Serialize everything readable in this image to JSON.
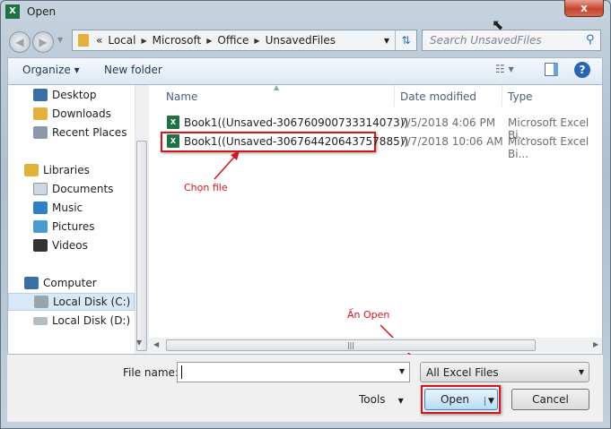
{
  "window": {
    "title": "Open",
    "close_label": "x",
    "app_icon": "excel-icon"
  },
  "address": {
    "overflow": "«",
    "crumbs": [
      "Local",
      "Microsoft",
      "Office",
      "UnsavedFiles"
    ]
  },
  "search": {
    "placeholder": "Search UnsavedFiles"
  },
  "toolbar": {
    "organize": "Organize ▾",
    "new_folder": "New folder"
  },
  "sidebar": {
    "items": [
      {
        "label": "Desktop",
        "icon": "desktop-icon",
        "color": "#3a6ea5"
      },
      {
        "label": "Downloads",
        "icon": "downloads-folder-icon",
        "color": "#e2b13c"
      },
      {
        "label": "Recent Places",
        "icon": "recent-places-icon",
        "color": "#8a98a8"
      },
      {
        "label": "Libraries",
        "icon": "libraries-icon",
        "color": "#e2b13c"
      },
      {
        "label": "Documents",
        "icon": "documents-icon",
        "color": "#cfd8e2"
      },
      {
        "label": "Music",
        "icon": "music-icon",
        "color": "#2f7fc8"
      },
      {
        "label": "Pictures",
        "icon": "pictures-icon",
        "color": "#4a9bd0"
      },
      {
        "label": "Videos",
        "icon": "videos-icon",
        "color": "#333"
      },
      {
        "label": "Computer",
        "icon": "computer-icon",
        "color": "#3a6ea5"
      },
      {
        "label": "Local Disk (C:)",
        "icon": "drive-c-icon",
        "color": "#9aa4ae"
      },
      {
        "label": "Local Disk (D:)",
        "icon": "drive-d-icon",
        "color": "#b4bcc4"
      }
    ]
  },
  "columns": {
    "name": "Name",
    "date": "Date modified",
    "type": "Type"
  },
  "files": [
    {
      "name": "Book1((Unsaved-306760900733314073))",
      "date": "7/5/2018 4:06 PM",
      "type": "Microsoft Excel Bi..."
    },
    {
      "name": "Book1((Unsaved-306764420643757885))",
      "date": "7/7/2018 10:06 AM",
      "type": "Microsoft Excel Bi..."
    }
  ],
  "annotations": {
    "choose_file": "Chọn file",
    "press_open": "Ấn Open"
  },
  "bottom": {
    "file_name_label": "File name:",
    "file_name_value": "",
    "filter": "All Excel Files",
    "tools": "Tools",
    "open": "Open",
    "cancel": "Cancel"
  }
}
